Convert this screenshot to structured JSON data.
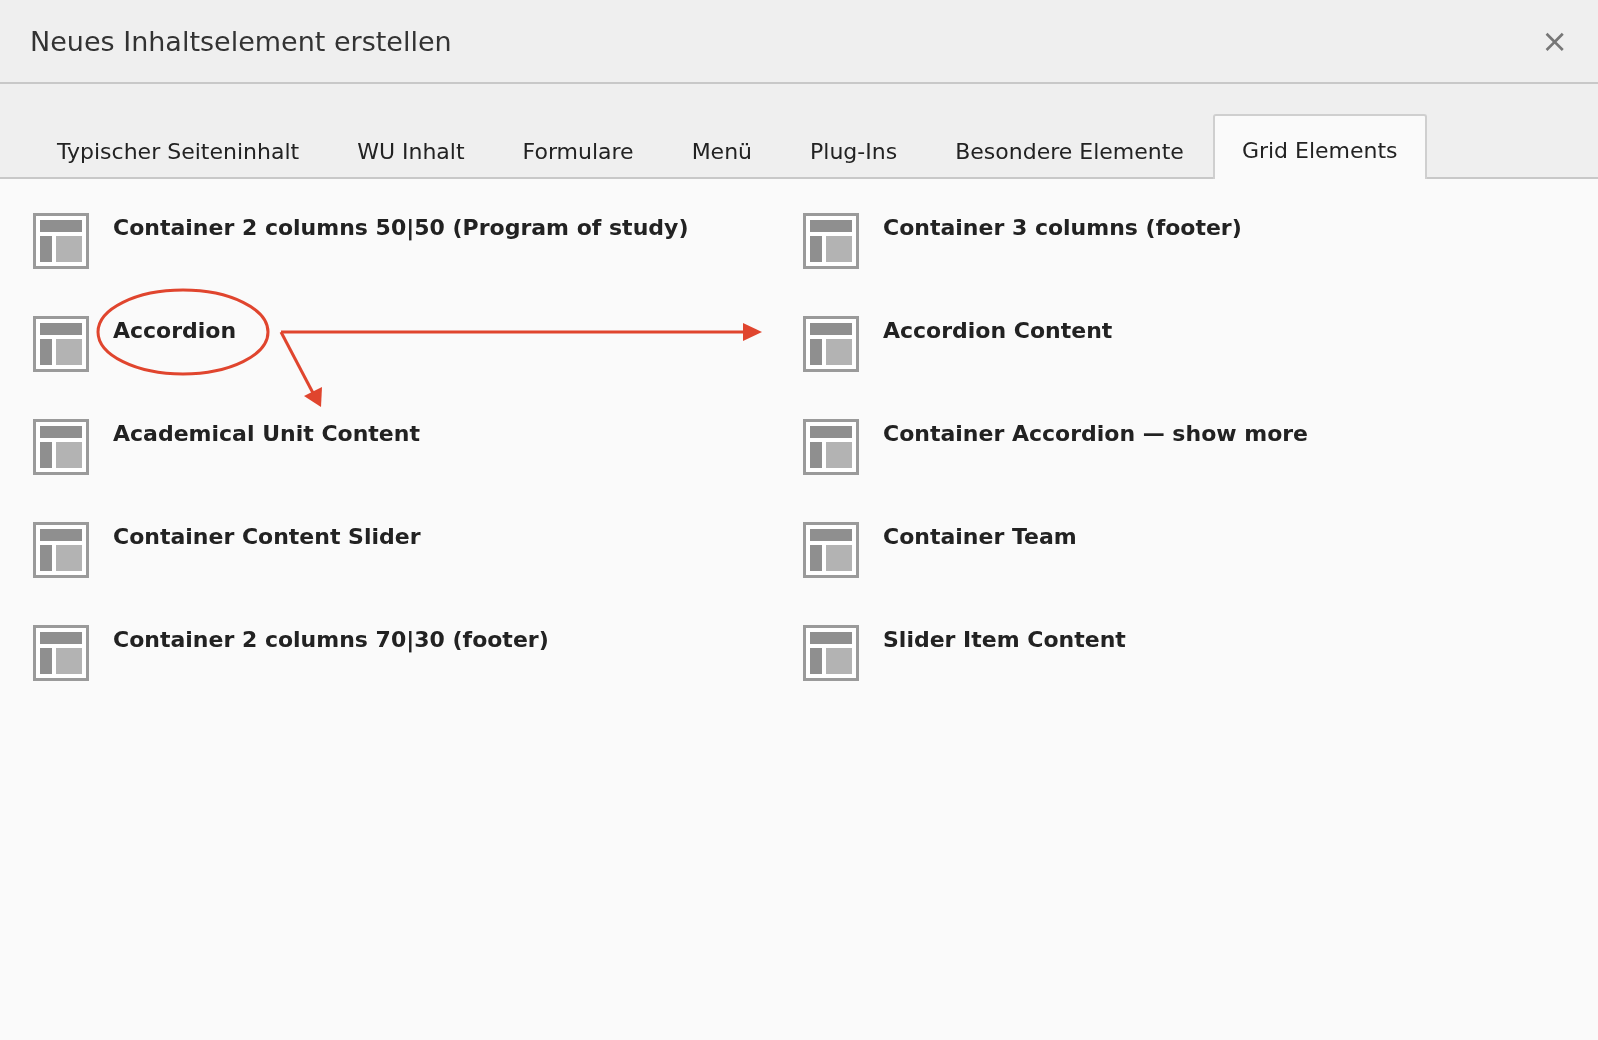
{
  "window": {
    "title": "Neues Inhaltselement erstellen",
    "close": "×"
  },
  "tabs": [
    {
      "label": "Typischer Seiteninhalt",
      "selected": false
    },
    {
      "label": "WU Inhalt",
      "selected": false
    },
    {
      "label": "Formulare",
      "selected": false
    },
    {
      "label": "Menü",
      "selected": false
    },
    {
      "label": "Plug-Ins",
      "selected": false
    },
    {
      "label": "Besondere Elemente",
      "selected": false
    },
    {
      "label": "Grid Elements",
      "selected": true
    }
  ],
  "elements": [
    {
      "label": "Container 2 columns 50|50 (Program of study)"
    },
    {
      "label": "Container 3 columns (footer)"
    },
    {
      "label": "Accordion"
    },
    {
      "label": "Accordion Content"
    },
    {
      "label": "Academical Unit Content"
    },
    {
      "label": "Container Accordion — show more"
    },
    {
      "label": "Container Content Slider"
    },
    {
      "label": "Container Team"
    },
    {
      "label": "Container 2 columns 70|30 (footer)"
    },
    {
      "label": "Slider Item Content"
    }
  ]
}
